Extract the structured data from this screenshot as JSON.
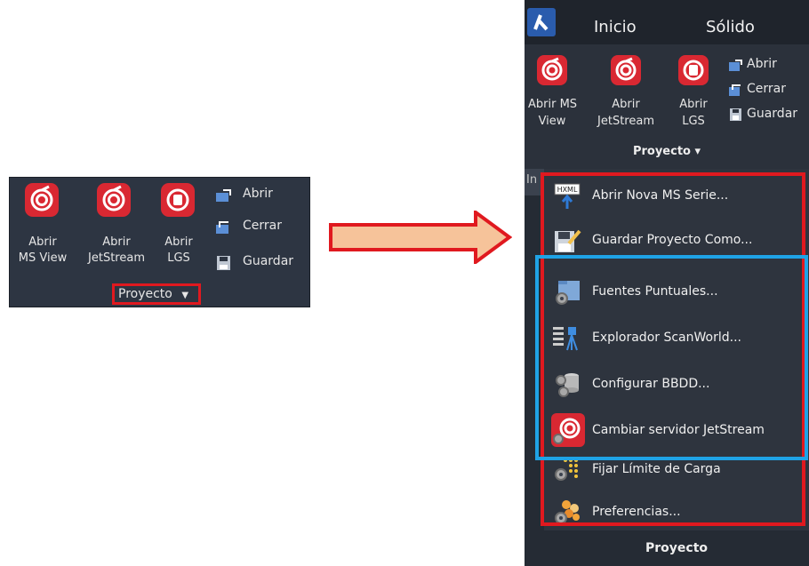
{
  "small_ribbon": {
    "buttons": [
      {
        "label": "Abrir\nMS View",
        "icon": "leica-swirl-icon"
      },
      {
        "label": "Abrir\nJetStream",
        "icon": "leica-swirl-icon"
      },
      {
        "label": "Abrir\nLGS",
        "icon": "leica-database-icon"
      }
    ],
    "list": [
      {
        "label": "Abrir",
        "icon": "open-folder-icon"
      },
      {
        "label": "Cerrar",
        "icon": "close-folder-icon"
      },
      {
        "label": "Guardar",
        "icon": "floppy-disk-icon"
      }
    ],
    "group_label": "Proyecto"
  },
  "panel": {
    "tabs": [
      {
        "label": "Inicio"
      },
      {
        "label": "Sólido"
      }
    ],
    "ribbon": {
      "buttons": [
        {
          "label": "Abrir MS\nView",
          "icon": "leica-swirl-icon"
        },
        {
          "label": "Abrir\nJetStream",
          "icon": "leica-swirl-icon"
        },
        {
          "label": "Abrir\nLGS",
          "icon": "leica-database-icon"
        }
      ],
      "list": [
        {
          "label": "Abrir",
          "icon": "open-folder-icon"
        },
        {
          "label": "Cerrar",
          "icon": "close-folder-icon"
        },
        {
          "label": "Guardar",
          "icon": "floppy-disk-icon"
        }
      ],
      "group_label": "Proyecto ▾"
    },
    "stub_label": "In",
    "menu_items": [
      {
        "label": "Abrir Nova MS Serie...",
        "icon": "hxml-upload-icon"
      },
      {
        "label": "Guardar Proyecto Como...",
        "icon": "save-as-icon"
      },
      {
        "label": "Fuentes Puntuales...",
        "icon": "folder-gears-icon"
      },
      {
        "label": "Explorador ScanWorld...",
        "icon": "scanworld-icon"
      },
      {
        "label": "Configurar BBDD...",
        "icon": "database-gears-icon"
      },
      {
        "label": "Cambiar servidor JetStream",
        "icon": "jetstream-gears-icon"
      },
      {
        "label": "Fijar Límite de Carga",
        "icon": "load-limit-icon"
      },
      {
        "label": "Preferencias...",
        "icon": "preferences-icon"
      }
    ],
    "footer_label": "Proyecto"
  },
  "colors": {
    "highlight_red": "#e0191f",
    "highlight_blue": "#1fa3e6",
    "icon_red": "#d92832",
    "arrow_fill": "#f6c39a",
    "ribbon_bg": "#2d3542"
  }
}
